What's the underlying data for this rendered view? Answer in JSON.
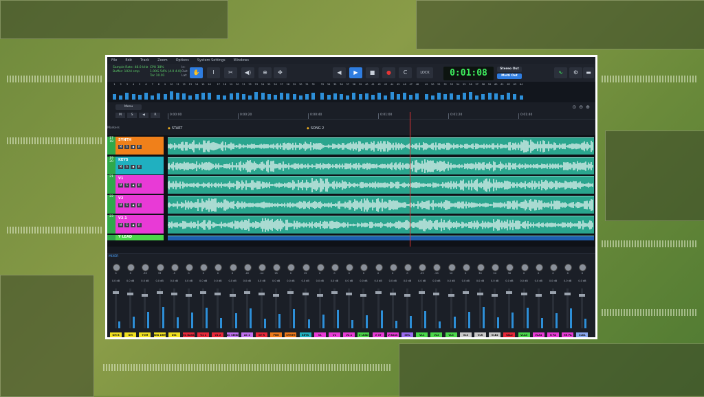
{
  "menu": [
    "File",
    "Edit",
    "Track",
    "Zoom",
    "Options",
    "System Settings",
    "Windows"
  ],
  "info": {
    "left": "Sample Rate: 48.0 kHz\nBuffer: 1024 smp",
    "mid": "CPU 38%\n1.00G 54% (4.0 4.0)\nTac 10.01",
    "right": "In:\nOut:\nLat:"
  },
  "transport": {
    "time": "0:01:08",
    "lock": "LOCK",
    "stereo_out": "Stereo Out",
    "multi_out": "Multi Out"
  },
  "meter_numbers": [
    "1",
    "2",
    "3",
    "4",
    "5",
    "6",
    "7",
    "8",
    "9",
    "10",
    "11",
    "12",
    "13",
    "14",
    "15",
    "16",
    "17",
    "18",
    "19",
    "20",
    "21",
    "22",
    "23",
    "24",
    "25",
    "26",
    "27",
    "28",
    "29",
    "30",
    "31",
    "32",
    "33",
    "34",
    "35",
    "36",
    "37",
    "38",
    "39",
    "40",
    "41",
    "42",
    "43",
    "44",
    "45",
    "46",
    "47",
    "48",
    "49",
    "50",
    "51",
    "52",
    "53",
    "54",
    "55",
    "56",
    "57",
    "58",
    "59",
    "60",
    "61",
    "62",
    "63",
    "64"
  ],
  "meter_levels": [
    0.4,
    0.3,
    0.5,
    0.4,
    0.35,
    0.5,
    0.3,
    0.45,
    0.4,
    0.6,
    0.5,
    0.45,
    0.3,
    0.4,
    0.5,
    0.5,
    0.35,
    0.3,
    0.45,
    0.5,
    0.4,
    0.3,
    0.55,
    0.5,
    0.4,
    0.35,
    0.5,
    0.45,
    0.4,
    0.3,
    0.4,
    0.5,
    0.5,
    0.35,
    0.45,
    0.4,
    0.3,
    0.5,
    0.4,
    0.45,
    0.35,
    0.5,
    0.3,
    0.55,
    0.4,
    0.5,
    0.35,
    0.45,
    0.4,
    0.3,
    0.5,
    0.4,
    0.45,
    0.35,
    0.5,
    0.55,
    0.3,
    0.4,
    0.5,
    0.45,
    0.35,
    0.5,
    0.4,
    0.3
  ],
  "timeline": {
    "menu": "Menu",
    "ticks": [
      "0:00:00",
      "0:00:20",
      "0:00:40",
      "0:01:00",
      "0:01:20",
      "0:01:40"
    ],
    "markers": [
      "START",
      "SONG 2"
    ],
    "markers_label": "Markers"
  },
  "tracks": [
    {
      "num": "17\n18",
      "name": "SYNTH",
      "color": "#f0801a"
    },
    {
      "num": "19\n20",
      "name": "KEYS",
      "color": "#20b0c0"
    },
    {
      "num": "21",
      "name": "V1",
      "color": "#e83ad6"
    },
    {
      "num": "22",
      "name": "V2",
      "color": "#e83ad6"
    },
    {
      "num": "23",
      "name": "V2.1",
      "color": "#e83ad6"
    },
    {
      "num": "",
      "name": "Y LEAD",
      "color": "#4ad64a"
    }
  ],
  "track_buttons": [
    "M",
    "S",
    "◀",
    "R"
  ],
  "mixer": {
    "title": "MIXER",
    "strips": [
      {
        "label": "GM B",
        "color": "#f0e020",
        "val": "0",
        "db": "0.0 dB"
      },
      {
        "label": "GM",
        "color": "#f0e020",
        "val": "0",
        "db": "0.0 dB"
      },
      {
        "label": "TOM",
        "color": "#f0e020",
        "val": "-39",
        "db": "0.0 dB"
      },
      {
        "label": "SNS DRM",
        "color": "#f0e020",
        "val": "33",
        "db": "0.0 dB"
      },
      {
        "label": "DIS",
        "color": "#f0e020",
        "val": "-5",
        "db": "0.0 dB"
      },
      {
        "label": "E1 BASS",
        "color": "#e8283a",
        "val": "0",
        "db": "0.0 dB"
      },
      {
        "label": "V1 1",
        "color": "#e8283a",
        "val": "0",
        "db": "0.0 dB"
      },
      {
        "label": "V1 2",
        "color": "#e8283a",
        "val": "0",
        "db": "0.0 dB"
      },
      {
        "label": "AC SEND",
        "color": "#c070f0",
        "val": "0",
        "db": "0.0 dB"
      },
      {
        "label": "AC 2",
        "color": "#c070f0",
        "val": "-22",
        "db": "0.0 dB"
      },
      {
        "label": "GT R",
        "color": "#e8283a",
        "val": "-14",
        "db": "0.0 dB"
      },
      {
        "label": "PNO",
        "color": "#f07a1a",
        "val": "25",
        "db": "0.0 dB"
      },
      {
        "label": "SYNTH",
        "color": "#f07a1a",
        "val": "0",
        "db": "0.0 dB"
      },
      {
        "label": "KEYS",
        "color": "#20b0c0",
        "val": "15",
        "db": "0.0 dB"
      },
      {
        "label": "V1",
        "color": "#e83ad6",
        "val": "0",
        "db": "0.0 dB"
      },
      {
        "label": "V2",
        "color": "#e83ad6",
        "val": "0",
        "db": "0.0 dB"
      },
      {
        "label": "V2.1",
        "color": "#e83ad6",
        "val": "0",
        "db": "0.0 dB"
      },
      {
        "label": "V LEAD",
        "color": "#4ad64a",
        "val": "0",
        "db": "0.0 dB"
      },
      {
        "label": "V GT",
        "color": "#e83ad6",
        "val": "0",
        "db": "0.0 dB"
      },
      {
        "label": "V BASS",
        "color": "#e83ad6",
        "val": "0",
        "db": "0.0 dB"
      },
      {
        "label": "SML",
        "color": "#9a6af0",
        "val": "0",
        "db": "0.0 dB"
      },
      {
        "label": "VL1",
        "color": "#4ad64a",
        "val": "-25",
        "db": "0.0 dB"
      },
      {
        "label": "VL2",
        "color": "#4ad64a",
        "val": "-20",
        "db": "0.0 dB"
      },
      {
        "label": "VL3",
        "color": "#4ad64a",
        "val": "10",
        "db": "0.0 dB"
      },
      {
        "label": "VLS",
        "color": "#c8c8c8",
        "val": "0",
        "db": "0.0 dB"
      },
      {
        "label": "VLR",
        "color": "#c8c8c8",
        "val": "30",
        "db": "0.0 dB"
      },
      {
        "label": "VLB2",
        "color": "#c8c8c8",
        "val": "24",
        "db": "0.0 dB"
      },
      {
        "label": "VAL2",
        "color": "#e8283a",
        "val": "36",
        "db": "0.0 dB"
      },
      {
        "label": "VLA3",
        "color": "#4ad64a",
        "val": "0",
        "db": "0.0 dB"
      },
      {
        "label": "VLA4",
        "color": "#e83ad6",
        "val": "0",
        "db": "0.0 dB"
      },
      {
        "label": "R PA",
        "color": "#e83ad6",
        "val": "0",
        "db": "0.0 dB"
      },
      {
        "label": "HR PA",
        "color": "#e83ad6",
        "val": "0",
        "db": "0.0 dB"
      },
      {
        "label": "CLK1",
        "color": "#8aa8f0",
        "val": "0",
        "db": "0.0 dB"
      }
    ]
  }
}
